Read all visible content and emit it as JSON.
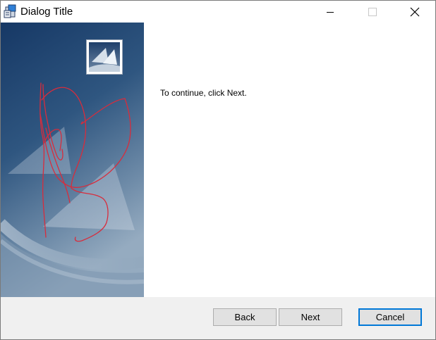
{
  "window": {
    "title": "Dialog Title",
    "icons": {
      "app": "installer-icon",
      "minimize": "minimize-icon",
      "maximize": "maximize-icon",
      "close": "close-icon"
    }
  },
  "banner": {
    "logo_icon": "setup-logo-icon"
  },
  "content": {
    "instruction": "To continue, click Next."
  },
  "buttons": {
    "back": "Back",
    "next": "Next",
    "cancel": "Cancel"
  },
  "colors": {
    "banner_top": "#173a66",
    "banner_bottom": "#8ea6bd",
    "annotation_red": "#d82c3c",
    "button_bar": "#f0f0f0",
    "focus_border": "#0078d7"
  }
}
